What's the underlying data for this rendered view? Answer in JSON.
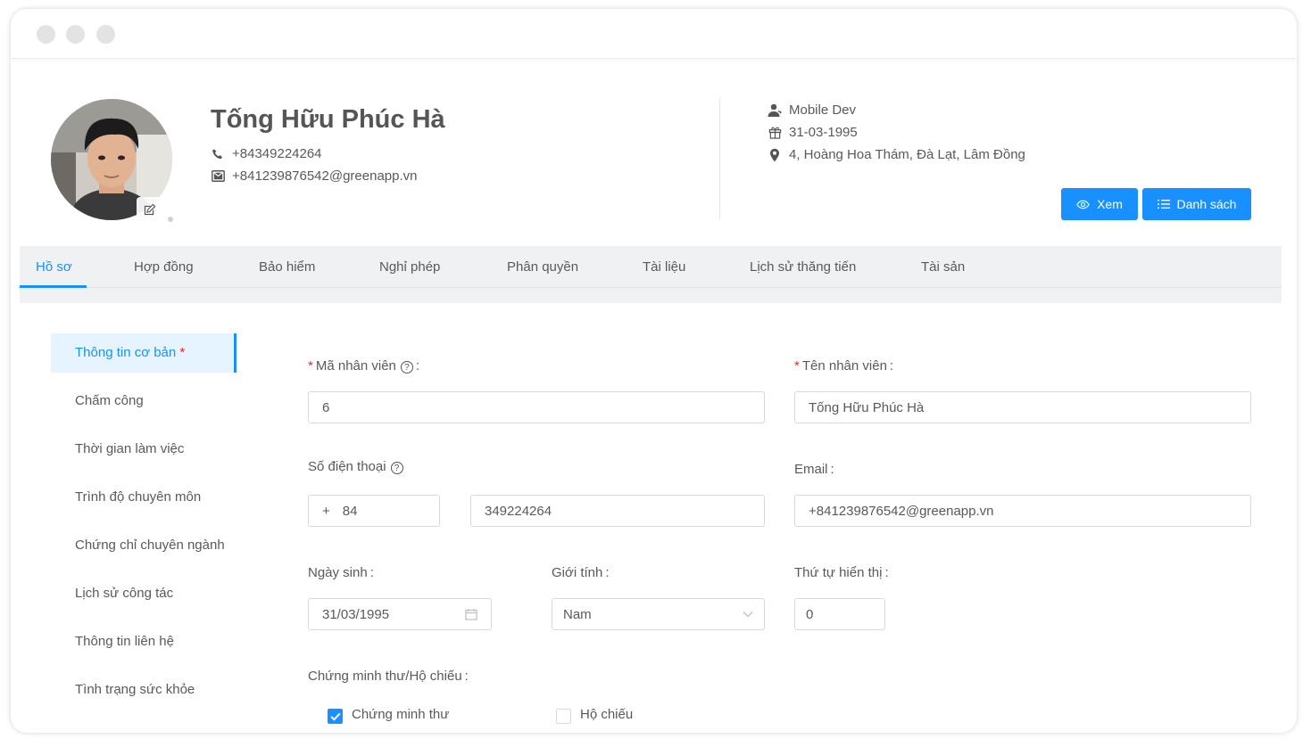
{
  "profile": {
    "name": "Tống Hữu Phúc Hà",
    "phone": "+84349224264",
    "email": "+841239876542@greenapp.vn",
    "position": "Mobile Dev",
    "birthday": "31-03-1995",
    "address": "4, Hoàng Hoa Thám, Đà Lạt, Lâm Đồng"
  },
  "actions": {
    "view_label": "Xem",
    "list_label": "Danh sách"
  },
  "tabs": [
    {
      "label": "Hồ sơ"
    },
    {
      "label": "Hợp đồng"
    },
    {
      "label": "Bảo hiểm"
    },
    {
      "label": "Nghỉ phép"
    },
    {
      "label": "Phân quyền"
    },
    {
      "label": "Tài liệu"
    },
    {
      "label": "Lịch sử thăng tiến"
    },
    {
      "label": "Tài sản"
    }
  ],
  "side_menu": [
    {
      "label": "Thông tin cơ bản",
      "required_mark": "*"
    },
    {
      "label": "Chấm công"
    },
    {
      "label": "Thời gian làm việc"
    },
    {
      "label": "Trình độ chuyên môn"
    },
    {
      "label": "Chứng chỉ chuyên ngành"
    },
    {
      "label": "Lịch sử công tác"
    },
    {
      "label": "Thông tin liên hệ"
    },
    {
      "label": "Tình trạng sức khỏe"
    }
  ],
  "form": {
    "required_mark": "*",
    "help_glyph": "?",
    "employee_id": {
      "label": "Mã nhân viên",
      "colon": ":",
      "value": "6"
    },
    "employee_name": {
      "label": "Tên nhân viên",
      "colon": ":",
      "value": "Tống Hữu Phúc Hà"
    },
    "phone": {
      "label": "Số điện thoại",
      "prefix_plus": "+",
      "country_code": "84",
      "value": "349224264"
    },
    "email": {
      "label": "Email",
      "colon": ":",
      "value": "+841239876542@greenapp.vn"
    },
    "dob": {
      "label": "Ngày sinh",
      "colon": ":",
      "value": "31/03/1995"
    },
    "gender": {
      "label": "Giới tính",
      "colon": ":",
      "value": "Nam"
    },
    "display_order": {
      "label": "Thứ tự hiển thị",
      "colon": ":",
      "value": "0"
    },
    "id_doc": {
      "label": "Chứng minh thư/Hộ chiếu",
      "colon": ":"
    },
    "id_card": {
      "label": "Chứng minh thư",
      "checked": true
    },
    "passport": {
      "label": "Hộ chiếu",
      "checked": false
    }
  },
  "colors": {
    "accent": "#1890ff",
    "required": "#f5222d",
    "tabbar_bg": "#f0f1f3"
  }
}
